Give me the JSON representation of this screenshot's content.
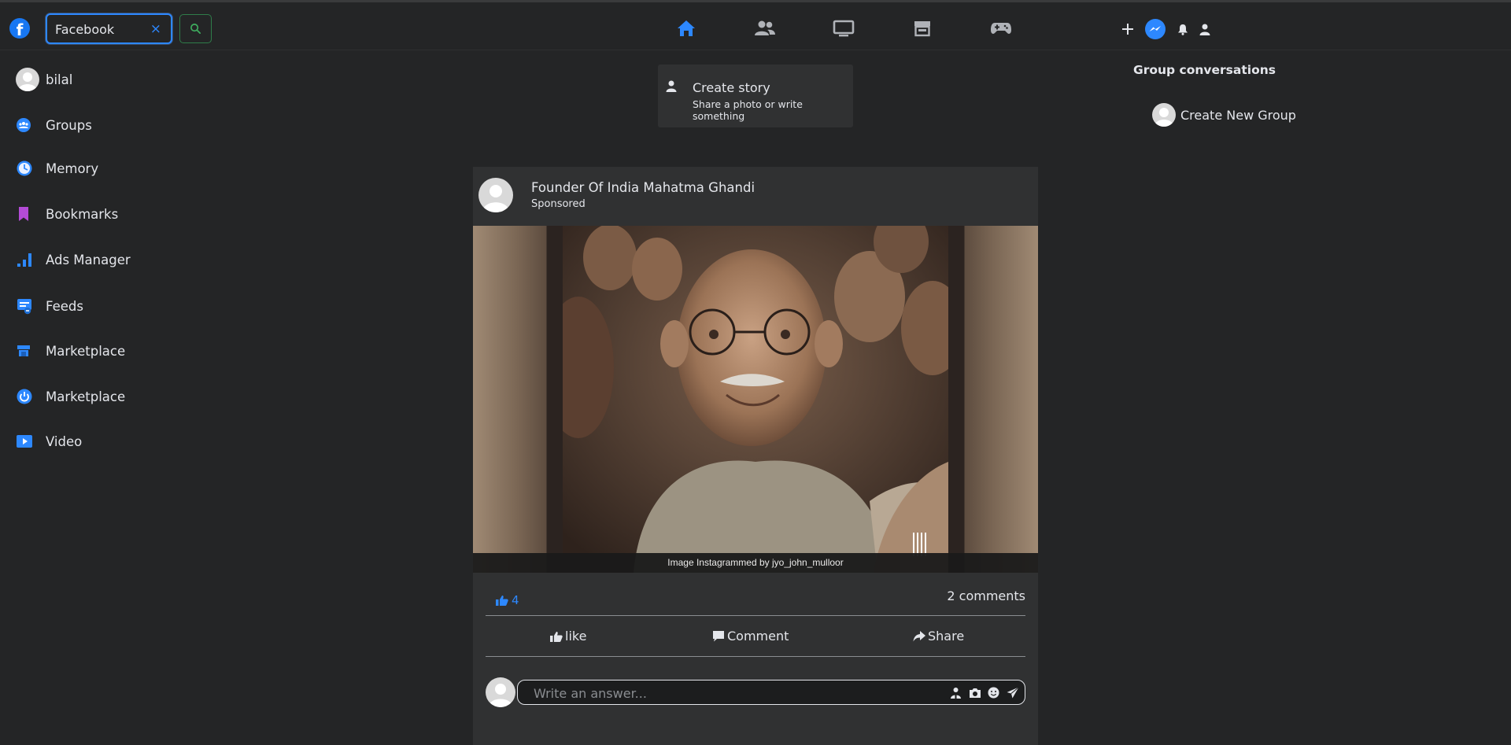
{
  "header": {
    "logo": "facebook-logo",
    "search": {
      "value": "Facebook",
      "clear_label": "×"
    },
    "nav": [
      {
        "icon": "home-icon",
        "active": true
      },
      {
        "icon": "friends-icon",
        "active": false
      },
      {
        "icon": "watch-icon",
        "active": false
      },
      {
        "icon": "marketplace-icon",
        "active": false
      },
      {
        "icon": "gaming-icon",
        "active": false
      }
    ],
    "right": [
      "plus-icon",
      "messenger-icon",
      "bell-icon",
      "profile-icon"
    ]
  },
  "sidebar": {
    "items": [
      {
        "label": "bilal",
        "icon": "avatar"
      },
      {
        "label": "Groups",
        "icon": "groups-icon"
      },
      {
        "label": "Memory",
        "icon": "memory-icon"
      },
      {
        "label": "Bookmarks",
        "icon": "bookmark-icon"
      },
      {
        "label": "Ads Manager",
        "icon": "ads-manager-icon"
      },
      {
        "label": "Feeds",
        "icon": "feeds-icon"
      },
      {
        "label": "Marketplace",
        "icon": "marketplace-icon"
      },
      {
        "label": "Marketplace",
        "icon": "power-icon"
      },
      {
        "label": "Video",
        "icon": "video-icon"
      }
    ]
  },
  "story": {
    "title": "Create story",
    "subtitle": "Share a photo or write something"
  },
  "right_col": {
    "title": "Group conversations",
    "create_label": "Create New Group"
  },
  "post": {
    "author": "Founder Of India Mahatma Ghandi",
    "sponsored": "Sponsored",
    "caption": "Image Instagrammed by jyo_john_mulloor",
    "likes": "4",
    "comments": "2 comments",
    "actions": {
      "like": "like",
      "comment": "Comment",
      "share": "Share"
    },
    "compose_placeholder": "Write an answer..."
  },
  "colors": {
    "background": "#242526",
    "surface": "#303132",
    "accent": "#2d88ff",
    "text": "#e4e6eb"
  }
}
